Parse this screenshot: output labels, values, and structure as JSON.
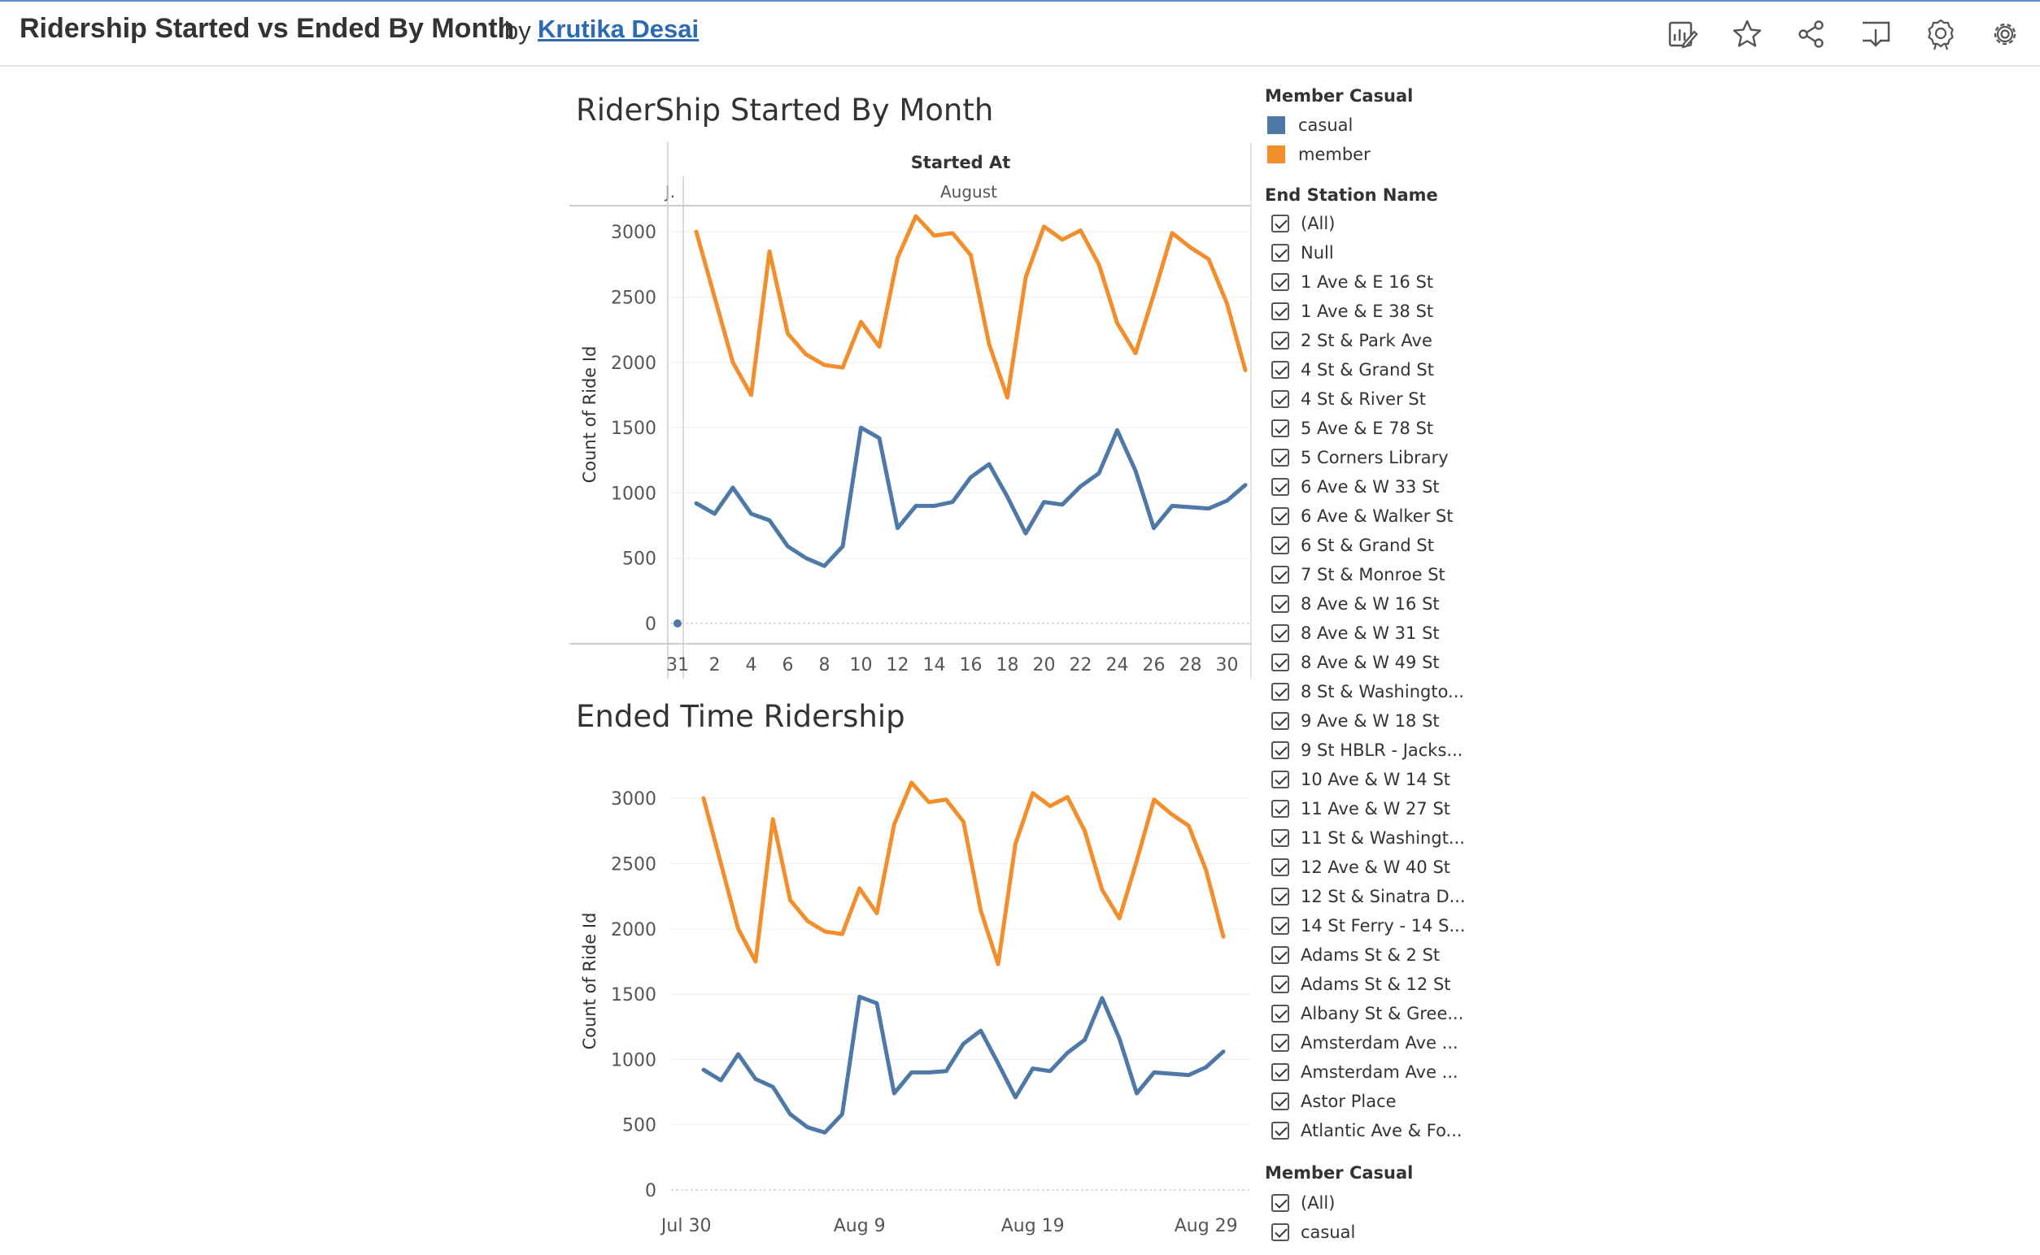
{
  "header": {
    "title": "Ridership Started vs Ended By Month",
    "by": "by",
    "author": "Krutika Desai",
    "toolbar": [
      "edit-icon",
      "star-icon",
      "share-icon",
      "download-icon",
      "award-icon",
      "gear-icon"
    ]
  },
  "colors": {
    "casual": "#4e79a7",
    "member": "#f28e2b",
    "link": "#2c6bb3"
  },
  "chart_data": [
    {
      "type": "line",
      "title": "RiderShip Started By Month",
      "header_label": "Started At",
      "month_labels": [
        "J.",
        "August"
      ],
      "ylabel": "Count of Ride Id",
      "ylim": [
        0,
        3200
      ],
      "yticks": [
        0,
        500,
        1000,
        1500,
        2000,
        2500,
        3000
      ],
      "xtick_labels": [
        "31",
        "2",
        "4",
        "6",
        "8",
        "10",
        "12",
        "14",
        "16",
        "18",
        "20",
        "22",
        "24",
        "26",
        "28",
        "30"
      ],
      "x": [
        1,
        2,
        3,
        4,
        5,
        6,
        7,
        8,
        9,
        10,
        11,
        12,
        13,
        14,
        15,
        16,
        17,
        18,
        19,
        20,
        21,
        22,
        23,
        24,
        25,
        26,
        27,
        28,
        29,
        30,
        31
      ],
      "extra_point": {
        "series": "casual",
        "day": "Jul 31",
        "value": 0
      },
      "series": [
        {
          "name": "casual",
          "values": [
            920,
            840,
            1040,
            840,
            790,
            590,
            500,
            440,
            590,
            1500,
            1420,
            730,
            900,
            900,
            930,
            1120,
            1220,
            970,
            690,
            930,
            910,
            1050,
            1150,
            1480,
            1170,
            730,
            900,
            890,
            880,
            940,
            1060
          ]
        },
        {
          "name": "member",
          "values": [
            3000,
            2500,
            2000,
            1750,
            2850,
            2220,
            2060,
            1980,
            1960,
            2310,
            2120,
            2800,
            3120,
            2970,
            2990,
            2820,
            2140,
            1730,
            2650,
            3040,
            2940,
            3010,
            2750,
            2300,
            2070,
            2520,
            2990,
            2880,
            2790,
            2450,
            1940
          ]
        }
      ]
    },
    {
      "type": "line",
      "title": "Ended Time Ridership",
      "ylabel": "Count of Ride Id",
      "ylim": [
        0,
        3200
      ],
      "yticks": [
        0,
        500,
        1000,
        1500,
        2000,
        2500,
        3000
      ],
      "xtick_labels": [
        "Jul 30",
        "Aug 9",
        "Aug 19",
        "Aug 29"
      ],
      "x": [
        1,
        2,
        3,
        4,
        5,
        6,
        7,
        8,
        9,
        10,
        11,
        12,
        13,
        14,
        15,
        16,
        17,
        18,
        19,
        20,
        21,
        22,
        23,
        24,
        25,
        26,
        27,
        28,
        29,
        30,
        31
      ],
      "series": [
        {
          "name": "casual",
          "values": [
            920,
            840,
            1040,
            850,
            790,
            580,
            480,
            440,
            580,
            1480,
            1430,
            740,
            900,
            900,
            910,
            1120,
            1220,
            970,
            710,
            930,
            910,
            1050,
            1150,
            1470,
            1160,
            740,
            900,
            890,
            880,
            940,
            1060
          ]
        },
        {
          "name": "member",
          "values": [
            3000,
            2500,
            2000,
            1750,
            2840,
            2220,
            2060,
            1980,
            1960,
            2310,
            2120,
            2800,
            3120,
            2970,
            2990,
            2820,
            2140,
            1730,
            2650,
            3040,
            2940,
            3010,
            2750,
            2300,
            2080,
            2520,
            2990,
            2880,
            2790,
            2450,
            1940
          ]
        }
      ]
    }
  ],
  "legend": {
    "title": "Member Casual",
    "items": [
      {
        "label": "casual"
      },
      {
        "label": "member"
      }
    ]
  },
  "filter_end_station": {
    "title": "End Station Name",
    "items": [
      "(All)",
      "Null",
      "1 Ave & E 16 St",
      "1 Ave & E 38 St",
      "2 St & Park Ave",
      "4 St & Grand St",
      "4 St & River St",
      "5 Ave & E 78 St",
      "5 Corners Library",
      "6 Ave & W 33 St",
      "6 Ave & Walker St",
      "6 St & Grand St",
      "7 St & Monroe St",
      "8 Ave & W 16 St",
      "8 Ave & W 31 St",
      "8 Ave & W 49 St",
      "8 St & Washingto...",
      "9 Ave & W 18 St",
      "9 St HBLR - Jacks...",
      "10 Ave & W 14 St",
      "11 Ave & W 27 St",
      "11 St & Washingt...",
      "12 Ave & W 40 St",
      "12 St & Sinatra D...",
      "14 St Ferry - 14 S...",
      "Adams St & 2 St",
      "Adams St & 12 St",
      "Albany St & Gree...",
      "Amsterdam Ave ...",
      "Amsterdam Ave ...",
      "Astor Place",
      "Atlantic Ave & Fo..."
    ]
  },
  "filter_member": {
    "title": "Member Casual",
    "items": [
      "(All)",
      "casual"
    ]
  }
}
